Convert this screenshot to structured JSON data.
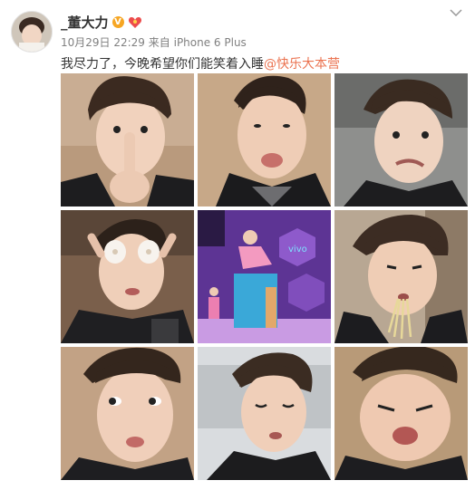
{
  "post": {
    "username": "_董大力",
    "verified_icon": "verified-v-icon",
    "badge_icon": "heart-badge-icon",
    "timestamp": "10月29日 22:29",
    "source_prefix": "来自",
    "source_device": "iPhone 6 Plus",
    "text": "我尽力了，今晚希望你们能笑着入睡",
    "mention": "@快乐大本营",
    "menu_icon": "chevron-down-icon"
  },
  "photos": [
    {
      "name": "photo-finger-on-nose"
    },
    {
      "name": "photo-pout-face"
    },
    {
      "name": "photo-frown-face"
    },
    {
      "name": "photo-eggs-on-eyes"
    },
    {
      "name": "photo-stage-performance"
    },
    {
      "name": "photo-eating-noodles"
    },
    {
      "name": "photo-side-glance"
    },
    {
      "name": "photo-sleepy-face"
    },
    {
      "name": "photo-squished-face"
    }
  ],
  "colors": {
    "accent_link": "#eb7350",
    "text_primary": "#333333",
    "text_meta": "#808080",
    "badge_orange": "#f6a623"
  }
}
